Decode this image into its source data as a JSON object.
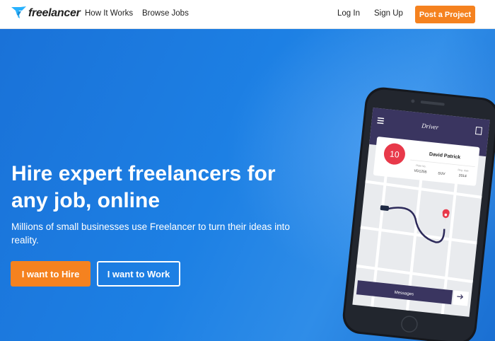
{
  "nav": {
    "logo_text": "freelancer",
    "how_it_works": "How It Works",
    "browse_jobs": "Browse Jobs",
    "log_in": "Log In",
    "sign_up": "Sign Up",
    "post_project": "Post a Project"
  },
  "hero": {
    "headline_line1": "Hire expert freelancers for",
    "headline_line2": "any job, online",
    "subtext_line1": "Millions of small businesses use Freelancer to turn their ideas into",
    "subtext_line2": "reality.",
    "hire_button": "I want to Hire",
    "work_button": "I want to Work"
  },
  "phone_app": {
    "app_title": "Driver",
    "badge_number": "10",
    "driver_name": "David Patrick",
    "plate_label": "Plate No.",
    "plate_value": "VD1255",
    "type_value": "SUV",
    "year_label": "Reg. date",
    "year_value": "2014",
    "messages_label": "Messages"
  },
  "colors": {
    "accent_orange": "#f5821f",
    "hero_blue": "#1d80e4",
    "app_header": "#3a3560",
    "badge_red": "#e8394a"
  }
}
